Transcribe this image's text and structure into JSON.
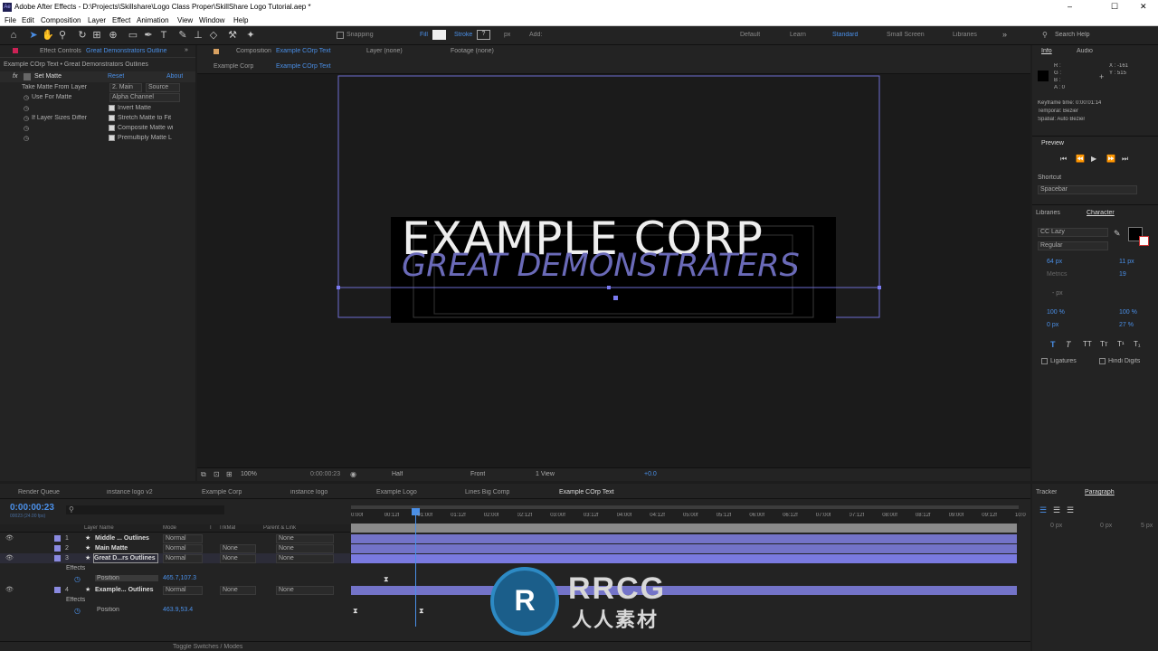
{
  "window": {
    "title": "Adobe After Effects - D:\\Projects\\Skillshare\\Logo Class Proper\\SkillShare Logo Tutorial.aep *"
  },
  "menu": [
    "File",
    "Edit",
    "Composition",
    "Layer",
    "Effect",
    "Animation",
    "View",
    "Window",
    "Help"
  ],
  "window_controls": {
    "minimize": "–",
    "maximize": "☐",
    "close": "✕"
  },
  "toolbar": {
    "snapping": "Snapping",
    "fill": "Fill",
    "stroke": "Stroke",
    "stroke_value": "?",
    "px": "px",
    "add": "Add:",
    "workspaces": [
      "Default",
      "Learn",
      "Standard",
      "Small Screen",
      "Libraries"
    ],
    "search": "Search Help"
  },
  "effect_controls": {
    "tab": "Effect Controls",
    "tab_target": "Great Demonstrators Outline",
    "crumb": "Example COrp Text • Great Demonstrators Outlines",
    "effect_name": "Set Matte",
    "reset": "Reset",
    "about": "About",
    "take_matte_label": "Take Matte From Layer",
    "take_matte_value": "2. Main",
    "source": "Source",
    "use_for_matte_label": "Use For Matte",
    "use_for_matte_value": "Alpha Channel",
    "invert": "Invert Matte",
    "if_sizes_label": "If Layer Sizes Differ",
    "stretch": "Stretch Matte to Fit",
    "composite": "Composite Matte wi",
    "premultiply": "Premultiply Matte L"
  },
  "composition": {
    "tab": "Composition",
    "tab_target": "Example COrp Text",
    "layer_tab": "Layer (none)",
    "footage_tab": "Footage (none)",
    "sub_tabs": [
      "Example Corp",
      "Example COrp Text"
    ],
    "title_text": "EXAMPLE CORP",
    "subtitle_text": "GREAT DEMONSTRATERS"
  },
  "viewer_bar": {
    "zoom": "100%",
    "time": "0:00:00:23",
    "resolution": "Half",
    "view": "Front",
    "views": "1 View",
    "exposure": "+0.0"
  },
  "info": {
    "tab": "Info",
    "audio": "Audio",
    "r": "R :",
    "g": "G :",
    "b": "B :",
    "a": "A : 0",
    "x": "X : -161",
    "y": "Y : 515",
    "kf_time": "Keyframe time: 0:00:01:14",
    "temporal": "Temporal: Bezier",
    "spatial": "Spatial: Auto Bezier"
  },
  "preview": {
    "tab": "Preview",
    "shortcut_label": "Shortcut",
    "shortcut_value": "Spacebar"
  },
  "character": {
    "libraries": "Libraries",
    "tab": "Character",
    "font": "CC Lazy",
    "style": "Regular",
    "size": "64 px",
    "leading": "11 px",
    "kerning": "Metrics",
    "tracking": "19",
    "stroke_px": "- px",
    "vscale": "100 %",
    "hscale": "100 %",
    "baseline": "0 px",
    "tsume": "27 %",
    "ligatures": "Ligatures",
    "hindi": "Hindi Digits"
  },
  "timeline": {
    "tabs": [
      "Render Queue",
      "instance logo v2",
      "Example Corp",
      "instance logo",
      "Example Logo",
      "Lines Big Comp",
      "Example COrp Text"
    ],
    "timecode": "0:00:00:23",
    "fps": "00023 (24.00 fps)",
    "headers": {
      "layer": "Layer Name",
      "mode": "Mode",
      "t": "T",
      "trkmat": "TrkMat",
      "parent": "Parent & Link"
    },
    "ruler": [
      "0:00f",
      "00:12f",
      "01:00f",
      "01:12f",
      "02:00f",
      "02:12f",
      "03:00f",
      "03:12f",
      "04:00f",
      "04:12f",
      "05:00f",
      "05:12f",
      "06:00f",
      "06:12f",
      "07:00f",
      "07:12f",
      "08:00f",
      "08:12f",
      "09:00f",
      "09:12f",
      "10:0"
    ],
    "layers": [
      {
        "num": "1",
        "name": "Middle ... Outlines",
        "mode": "Normal",
        "trkmat": "",
        "parent": "None"
      },
      {
        "num": "2",
        "name": "Main Matte",
        "mode": "Normal",
        "trkmat": "None",
        "parent": "None"
      },
      {
        "num": "3",
        "name": "Great D...rs Outlines",
        "mode": "Normal",
        "trkmat": "None",
        "parent": "None"
      },
      {
        "num": "4",
        "name": "Example... Outlines",
        "mode": "Normal",
        "trkmat": "None",
        "parent": "None"
      }
    ],
    "effects_label": "Effects",
    "position_label": "Position",
    "pos3": "465.7,107.3",
    "pos4": "463.9,53.4",
    "toggle": "Toggle Switches / Modes"
  },
  "tracker": {
    "tab": "Tracker",
    "paragraph": "Paragraph",
    "zero": "0 px",
    "five": "5 px"
  },
  "watermark": {
    "brand": "RRCG",
    "sub": "人人素材"
  }
}
